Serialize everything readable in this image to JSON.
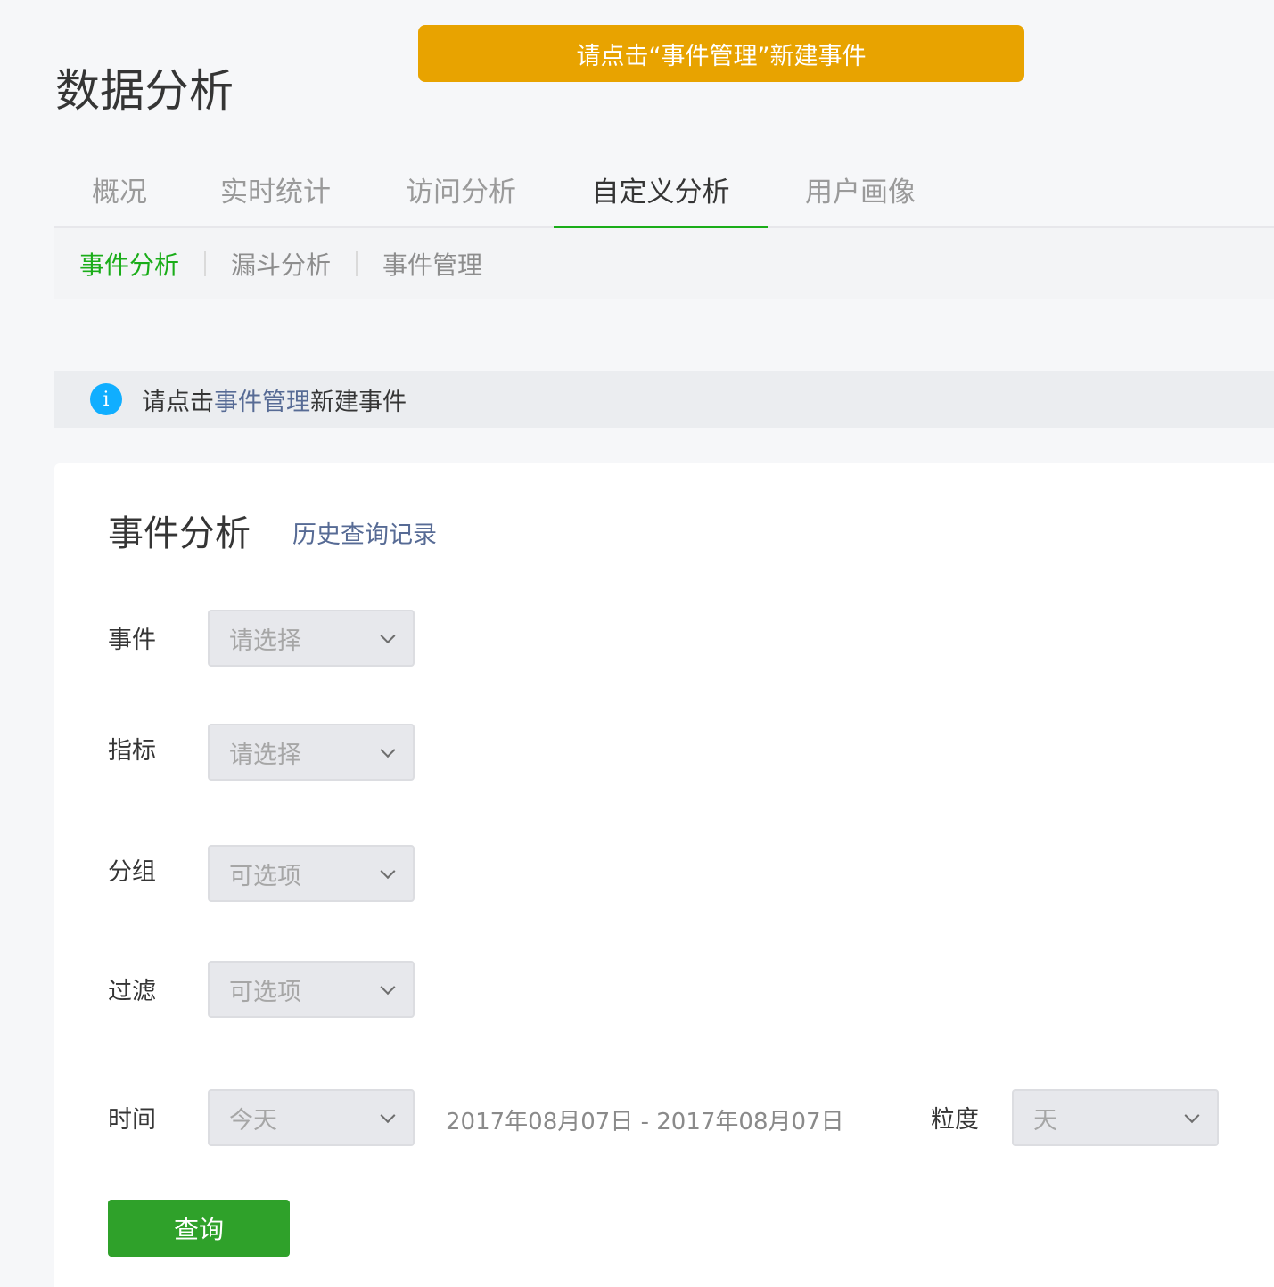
{
  "toast": {
    "text": "请点击“事件管理”新建事件"
  },
  "page": {
    "title": "数据分析"
  },
  "tabs": [
    {
      "label": "概况"
    },
    {
      "label": "实时统计"
    },
    {
      "label": "访问分析"
    },
    {
      "label": "自定义分析",
      "active": true
    },
    {
      "label": "用户画像"
    }
  ],
  "subnav": [
    {
      "label": "事件分析",
      "active": true
    },
    {
      "label": "漏斗分析"
    },
    {
      "label": "事件管理"
    }
  ],
  "info": {
    "prefix": "请点击",
    "link": "事件管理",
    "suffix": "新建事件",
    "icon": "info-icon"
  },
  "card": {
    "title": "事件分析",
    "history_link": "历史查询记录",
    "fields": {
      "event": {
        "label": "事件",
        "placeholder": "请选择"
      },
      "metric": {
        "label": "指标",
        "placeholder": "请选择"
      },
      "group": {
        "label": "分组",
        "placeholder": "可选项"
      },
      "filter": {
        "label": "过滤",
        "placeholder": "可选项"
      },
      "time": {
        "label": "时间",
        "value": "今天"
      },
      "date_range": "2017年08月07日 - 2017年08月07日",
      "granularity": {
        "label": "粒度",
        "value": "天"
      }
    },
    "query_button": "查询"
  },
  "colors": {
    "accent": "#1aad19",
    "warning": "#e8a300",
    "link": "#576b95",
    "info": "#10aeff"
  }
}
